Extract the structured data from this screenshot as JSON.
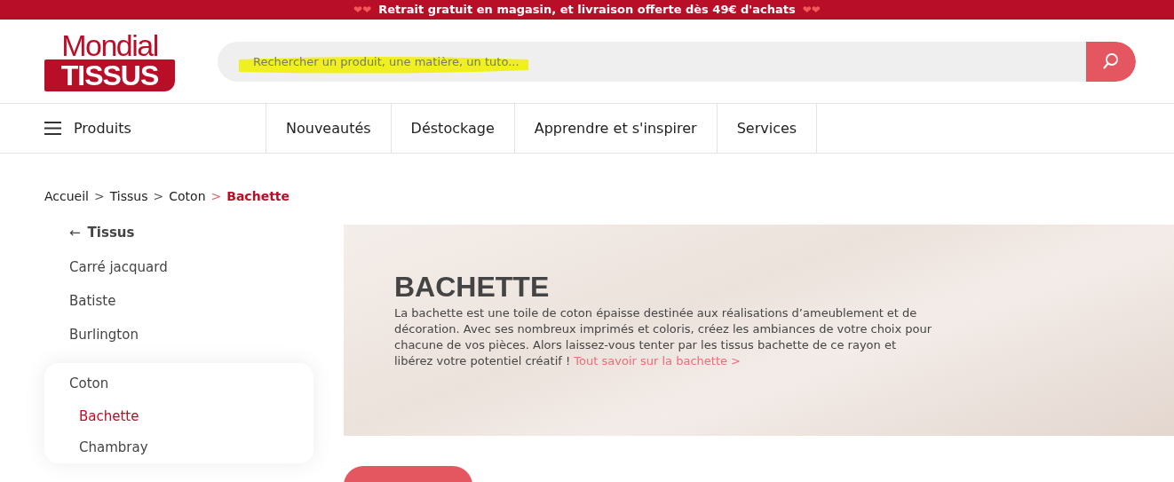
{
  "banner": {
    "hearts_left": "❤❤",
    "text": "Retrait gratuit en magasin, et livraison offerte dès 49€ d'achats",
    "hearts_right": "❤❤"
  },
  "logo": {
    "line_1": "Mondial",
    "line_2": "TISSUS"
  },
  "search": {
    "placeholder": "Rechercher un produit, une matière, un tuto..."
  },
  "nav": {
    "menu_label": "Produits",
    "items": [
      "Nouveautés",
      "Déstockage",
      "Apprendre et s'inspirer",
      "Services"
    ]
  },
  "breadcrumb_separator": ">",
  "breadcrumb": [
    {
      "label": "Accueil",
      "current": false
    },
    {
      "label": "Tissus",
      "current": false
    },
    {
      "label": "Coton",
      "current": false
    },
    {
      "label": "Bachette",
      "current": true
    }
  ],
  "sidebar": {
    "back_arrow": "←",
    "back_label": "Tissus",
    "items": [
      {
        "label": "Carré jacquard",
        "expanded": false
      },
      {
        "label": "Batiste",
        "expanded": false
      },
      {
        "label": "Burlington",
        "expanded": false
      },
      {
        "label": "Coton",
        "expanded": true,
        "children": [
          {
            "label": "Bachette",
            "selected": true
          },
          {
            "label": "Chambray",
            "selected": false
          }
        ]
      }
    ]
  },
  "hero": {
    "title": "BACHETTE",
    "description": "La bachette est une toile de coton épaisse destinée aux réalisations d’ameublement et de décoration. Avec ses nombreux imprimés et coloris, créez les ambiances de votre choix pour chacune de vos pièces. Alors laissez-vous tenter par les tissus bachette de ce rayon et libérez votre potentiel créatif !",
    "link": "Tout savoir sur la bachette >"
  }
}
